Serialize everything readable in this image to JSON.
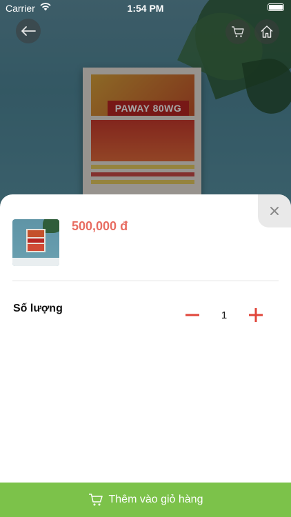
{
  "status_bar": {
    "carrier": "Carrier",
    "time": "1:54 PM"
  },
  "hero": {
    "product_brand_text": "PAWAY 80WG"
  },
  "icons": {
    "back": "arrow-left-icon",
    "cart": "cart-icon",
    "home": "home-icon",
    "close": "close-icon",
    "minus": "minus-icon",
    "plus": "plus-icon",
    "add_cart": "cart-icon"
  },
  "sheet": {
    "price": "500,000 đ",
    "quantity_label": "Số lượng",
    "quantity_value": "1",
    "add_to_cart_label": "Thêm vào giỏ hàng"
  },
  "colors": {
    "price": "#e86d62",
    "stepper": "#e0453a",
    "add_button": "#7cc24a"
  }
}
